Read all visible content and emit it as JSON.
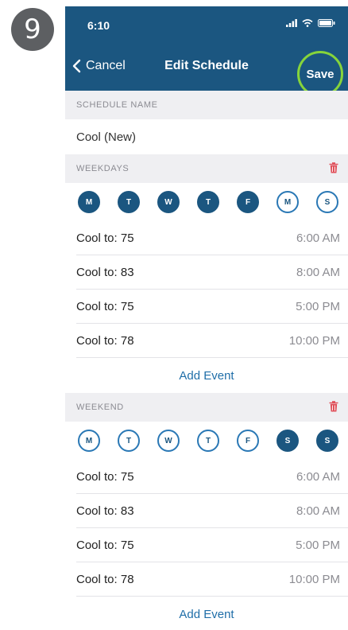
{
  "step_number": "9",
  "status_bar": {
    "time": "6:10"
  },
  "nav": {
    "cancel_label": "Cancel",
    "title": "Edit Schedule",
    "save_label": "Save"
  },
  "schedule_name": {
    "header": "SCHEDULE NAME",
    "value": "Cool (New)"
  },
  "weekdays": {
    "header": "WEEKDAYS",
    "days": [
      {
        "letter": "M",
        "selected": true
      },
      {
        "letter": "T",
        "selected": true
      },
      {
        "letter": "W",
        "selected": true
      },
      {
        "letter": "T",
        "selected": true
      },
      {
        "letter": "F",
        "selected": true
      },
      {
        "letter": "M",
        "selected": false
      },
      {
        "letter": "S",
        "selected": false
      }
    ],
    "events": [
      {
        "label": "Cool to: 75",
        "time": "6:00 AM"
      },
      {
        "label": "Cool to: 83",
        "time": "8:00 AM"
      },
      {
        "label": "Cool to: 75",
        "time": "5:00 PM"
      },
      {
        "label": "Cool to: 78",
        "time": "10:00 PM"
      }
    ],
    "add_event_label": "Add Event"
  },
  "weekend": {
    "header": "WEEKEND",
    "days": [
      {
        "letter": "M",
        "selected": false
      },
      {
        "letter": "T",
        "selected": false
      },
      {
        "letter": "W",
        "selected": false
      },
      {
        "letter": "T",
        "selected": false
      },
      {
        "letter": "F",
        "selected": false
      },
      {
        "letter": "S",
        "selected": true
      },
      {
        "letter": "S",
        "selected": true
      }
    ],
    "events": [
      {
        "label": "Cool to: 75",
        "time": "6:00 AM"
      },
      {
        "label": "Cool to: 83",
        "time": "8:00 AM"
      },
      {
        "label": "Cool to: 75",
        "time": "5:00 PM"
      },
      {
        "label": "Cool to: 78",
        "time": "10:00 PM"
      }
    ],
    "add_event_label": "Add Event"
  },
  "colors": {
    "primary": "#1b5680",
    "save_highlight": "#86d43b",
    "trash": "#e0505a",
    "link": "#1f6ea8"
  }
}
